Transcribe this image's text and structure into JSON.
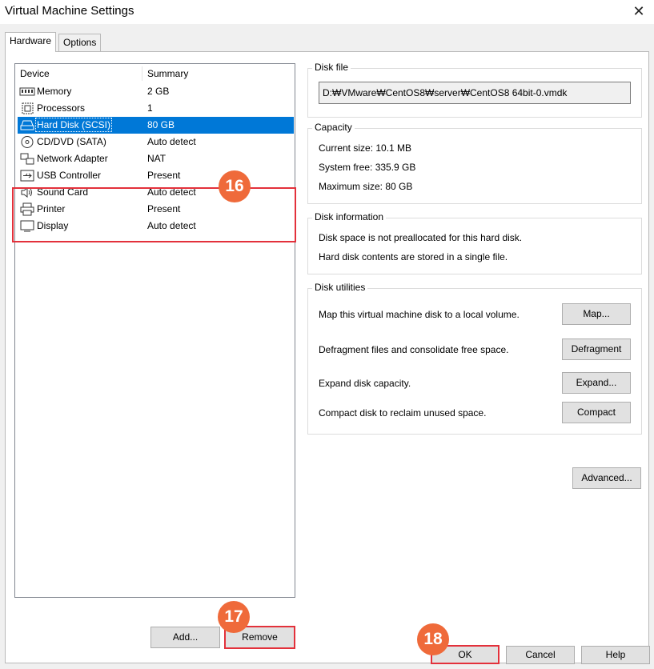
{
  "window": {
    "title": "Virtual Machine Settings"
  },
  "tabs": [
    {
      "label": "Hardware"
    },
    {
      "label": "Options"
    }
  ],
  "device_list": {
    "headers": {
      "device": "Device",
      "summary": "Summary"
    },
    "rows": [
      {
        "icon": "memory-icon",
        "name": "Memory",
        "summary": "2 GB"
      },
      {
        "icon": "processor-icon",
        "name": "Processors",
        "summary": "1"
      },
      {
        "icon": "hard-disk-icon",
        "name": "Hard Disk (SCSI)",
        "summary": "80 GB",
        "selected": true
      },
      {
        "icon": "cd-dvd-icon",
        "name": "CD/DVD (SATA)",
        "summary": "Auto detect"
      },
      {
        "icon": "network-adapter-icon",
        "name": "Network Adapter",
        "summary": "NAT"
      },
      {
        "icon": "usb-icon",
        "name": "USB Controller",
        "summary": "Present"
      },
      {
        "icon": "sound-icon",
        "name": "Sound Card",
        "summary": "Auto detect"
      },
      {
        "icon": "printer-icon",
        "name": "Printer",
        "summary": "Present"
      },
      {
        "icon": "display-icon",
        "name": "Display",
        "summary": "Auto detect"
      }
    ]
  },
  "device_buttons": {
    "add": "Add...",
    "remove": "Remove"
  },
  "annotations": {
    "step16": "16",
    "step17": "17",
    "step18": "18",
    "highlight_color": "#e3313b",
    "badge_color": "#ef6a3a"
  },
  "disk_file": {
    "title": "Disk file",
    "path": "D:₩VMware₩CentOS8₩server₩CentOS8 64bit-0.vmdk"
  },
  "capacity": {
    "title": "Capacity",
    "current": "Current size: 10.1 MB",
    "system_free": "System free: 335.9 GB",
    "maximum": "Maximum size: 80 GB"
  },
  "disk_information": {
    "title": "Disk information",
    "line1": "Disk space is not preallocated for this hard disk.",
    "line2": "Hard disk contents are stored in a single file."
  },
  "disk_utilities": {
    "title": "Disk utilities",
    "map": {
      "text": "Map this virtual machine disk to a local volume.",
      "button": "Map..."
    },
    "defragment": {
      "text": "Defragment files and consolidate free space.",
      "button": "Defragment"
    },
    "expand": {
      "text": "Expand disk capacity.",
      "button": "Expand..."
    },
    "compact": {
      "text": "Compact disk to reclaim unused space.",
      "button": "Compact"
    }
  },
  "advanced_button": "Advanced...",
  "dialog_buttons": {
    "ok": "OK",
    "cancel": "Cancel",
    "help": "Help"
  },
  "colors": {
    "selection": "#0078d7",
    "frame": "#f0f0f0"
  }
}
